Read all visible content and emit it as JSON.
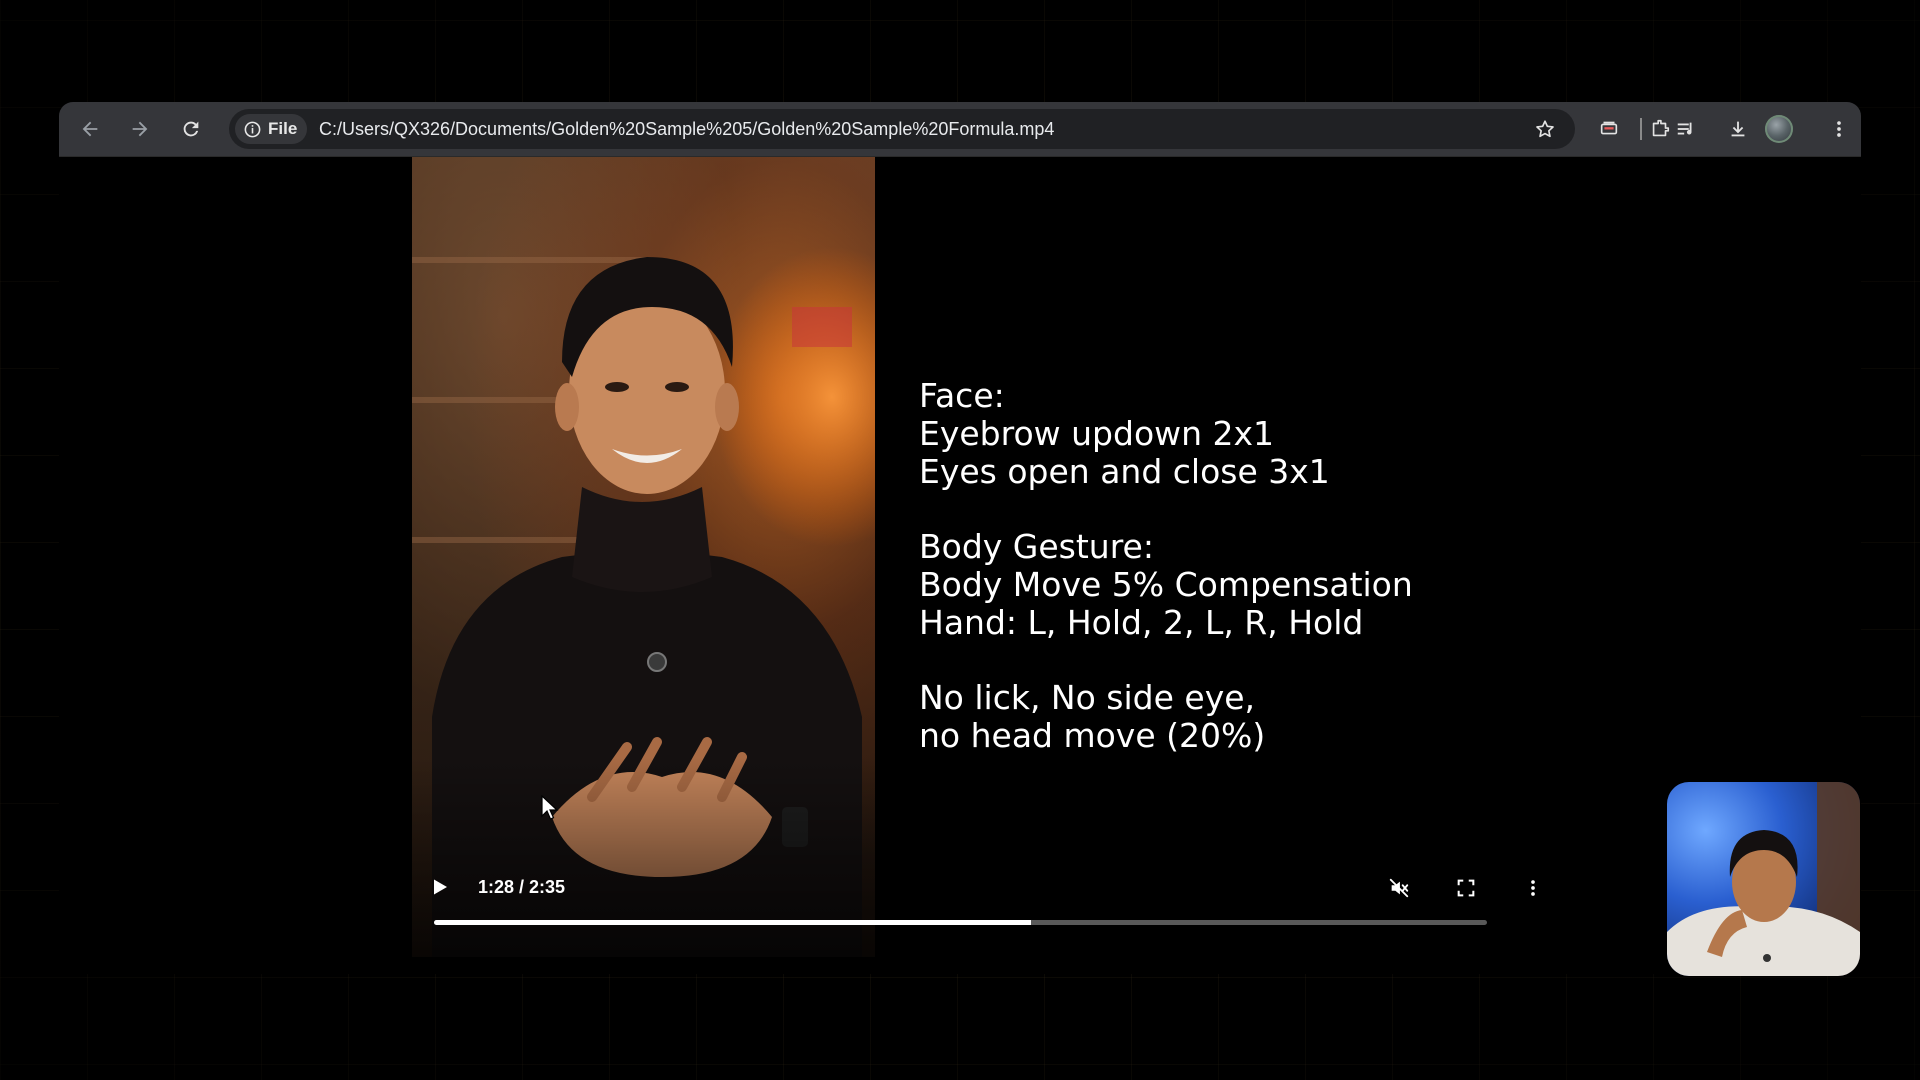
{
  "browser": {
    "nav": {
      "back_icon": "arrow-left-icon",
      "forward_icon": "arrow-right-icon",
      "reload_icon": "reload-icon"
    },
    "site_info_label": "File",
    "url": "C:/Users/QX326/Documents/Golden%20Sample%205/Golden%20Sample%20Formula.mp4",
    "toolbar_icons": [
      "cast-icon",
      "extensions-icon",
      "media-control-icon",
      "download-icon",
      "profile-avatar",
      "kebab-menu-icon"
    ]
  },
  "video": {
    "overlay_blocks": [
      [
        "Face:",
        "Eyebrow updown 2x1",
        "Eyes open and close 3x1"
      ],
      [
        "Body Gesture:",
        "Body Move 5% Compensation",
        "Hand: L, Hold, 2, L, R, Hold"
      ],
      [
        "No lick, No side eye,",
        "no head move (20%)"
      ]
    ],
    "time_display": "1:28 / 2:35",
    "progress_fraction": 0.567,
    "muted": true
  },
  "colors": {
    "toolbar_bg": "#35363a",
    "omnibox_bg": "#202124",
    "progress_fill": "#ffffff"
  }
}
